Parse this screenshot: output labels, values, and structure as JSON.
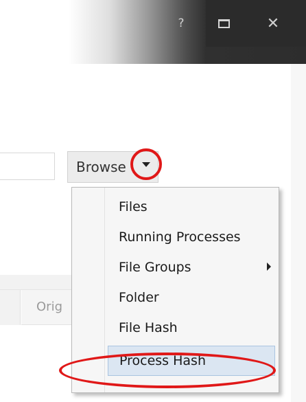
{
  "title_bar": {
    "help_label": "?",
    "maximize_icon": "maximize-icon",
    "close_label": "✕"
  },
  "browse": {
    "label": "Browse",
    "caret_icon": "caret-down-icon"
  },
  "dropdown": {
    "items": [
      {
        "label": "Files",
        "has_submenu": false
      },
      {
        "label": "Running Processes",
        "has_submenu": false
      },
      {
        "label": "File Groups",
        "has_submenu": true
      },
      {
        "label": "Folder",
        "has_submenu": false
      },
      {
        "label": "File Hash",
        "has_submenu": false
      },
      {
        "label": "Process Hash",
        "has_submenu": false,
        "highlighted": true
      }
    ]
  },
  "table": {
    "original_header": "Orig"
  },
  "colors": {
    "annotation": "#e01818",
    "highlight": "#dbe6f2",
    "title_bar_dark": "#2b2b2b"
  }
}
